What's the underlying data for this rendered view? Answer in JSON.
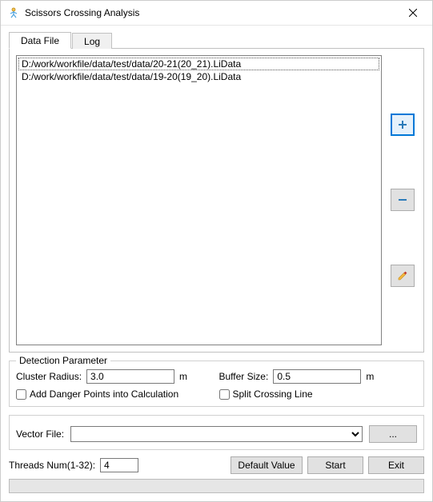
{
  "window": {
    "title": "Scissors Crossing Analysis"
  },
  "tabs": {
    "data_file": "Data File",
    "log": "Log"
  },
  "files": [
    "D:/work/workfile/data/test/data/20-21(20_21).LiData",
    "D:/work/workfile/data/test/data/19-20(19_20).LiData"
  ],
  "detection": {
    "legend": "Detection Parameter",
    "cluster_radius_label": "Cluster Radius:",
    "cluster_radius_value": "3.0",
    "unit_m_1": "m",
    "buffer_size_label": "Buffer Size:",
    "buffer_size_value": "0.5",
    "unit_m_2": "m",
    "add_danger_label": "Add Danger Points into Calculation",
    "split_crossing_label": "Split Crossing Line"
  },
  "vector": {
    "label": "Vector File:",
    "browse": "..."
  },
  "bottom": {
    "threads_label": "Threads Num(1-32):",
    "threads_value": "4",
    "default_value": "Default Value",
    "start": "Start",
    "exit": "Exit"
  },
  "icons": {
    "add": "add",
    "remove": "remove",
    "clear": "clear"
  }
}
